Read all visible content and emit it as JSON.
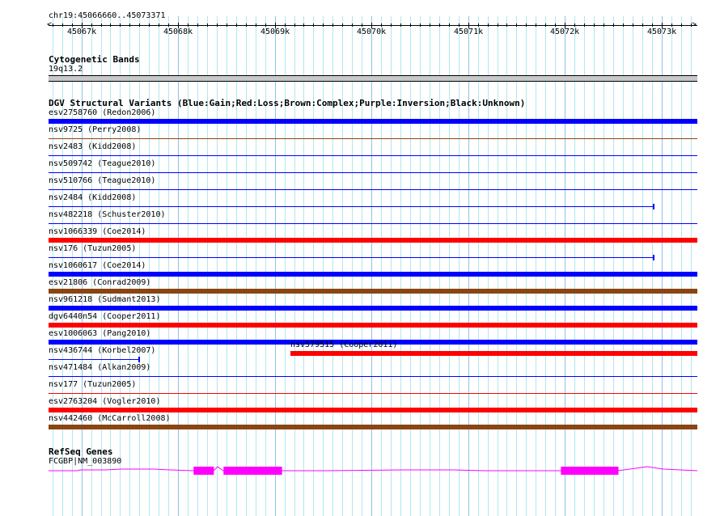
{
  "region": {
    "label": "chr19:45066660..45073371",
    "start": 45066660,
    "end": 45073371
  },
  "ruler": {
    "ticks": [
      "45067k",
      "45068k",
      "45069k",
      "45070k",
      "45071k",
      "45072k",
      "45073k"
    ],
    "tick_values": [
      45067000,
      45068000,
      45069000,
      45070000,
      45071000,
      45072000,
      45073000
    ]
  },
  "cytobands": {
    "title": "Cytogenetic Bands",
    "band": "19q13.2"
  },
  "dgv": {
    "title": "DGV Structural Variants (Blue:Gain;Red:Loss;Brown:Complex;Purple:Inversion;Black:Unknown)",
    "colors": {
      "blue": "#0000ff",
      "red": "#ff0000",
      "brown": "#8b4513"
    },
    "rows": [
      {
        "label": "esv2758760 (Redon2006)",
        "color": "blue",
        "thick": true,
        "start": 45066660,
        "end": 45073371
      },
      {
        "label": "nsv9725 (Perry2008)",
        "color": "brown",
        "thick": false,
        "start": 45066660,
        "end": 45073371
      },
      {
        "label": "nsv2483 (Kidd2008)",
        "color": "blue",
        "thick": false,
        "start": 45066660,
        "end": 45073371
      },
      {
        "label": "nsv509742 (Teague2010)",
        "color": "blue",
        "thick": false,
        "start": 45066660,
        "end": 45073371
      },
      {
        "label": "nsv510766 (Teague2010)",
        "color": "blue",
        "thick": false,
        "start": 45066660,
        "end": 45073371
      },
      {
        "label": "nsv2484 (Kidd2008)",
        "color": "blue",
        "thick": false,
        "start": 45066660,
        "end": 45072919,
        "endcap": true
      },
      {
        "label": "nsv482218 (Schuster2010)",
        "color": "blue",
        "thick": false,
        "start": 45066660,
        "end": 45073371
      },
      {
        "label": "nsv1066339 (Coe2014)",
        "color": "red",
        "thick": true,
        "start": 45066660,
        "end": 45073371
      },
      {
        "label": "nsv176 (Tuzun2005)",
        "color": "blue",
        "thick": false,
        "start": 45066660,
        "end": 45072919,
        "endcap": true
      },
      {
        "label": "nsv1060617 (Coe2014)",
        "color": "blue",
        "thick": true,
        "start": 45066660,
        "end": 45073371
      },
      {
        "label": "esv21806 (Conrad2009)",
        "color": "brown",
        "thick": true,
        "start": 45066660,
        "end": 45073371
      },
      {
        "label": "nsv961218 (Sudmant2013)",
        "color": "blue",
        "thick": true,
        "start": 45066660,
        "end": 45073371
      },
      {
        "label": "dgv6440n54 (Cooper2011)",
        "color": "red",
        "thick": true,
        "start": 45066660,
        "end": 45073371
      },
      {
        "label": "esv1006063 (Pang2010)",
        "color": "blue",
        "thick": true,
        "start": 45066660,
        "end": 45073371
      },
      {
        "label": "nsv436744 (Korbel2007)",
        "color": "blue",
        "thick": false,
        "start": 45066660,
        "end": 45067597,
        "endcap": true,
        "extra": {
          "label": "nsv579515 (Cooper2011)",
          "color": "red",
          "thick": true,
          "start": 45069162,
          "end": 45073371
        }
      },
      {
        "label": "nsv471484 (Alkan2009)",
        "color": "blue",
        "thick": false,
        "start": 45066660,
        "end": 45073371
      },
      {
        "label": "nsv177 (Tuzun2005)",
        "color": "red",
        "thick": false,
        "start": 45066660,
        "end": 45073371
      },
      {
        "label": "esv2763204 (Vogler2010)",
        "color": "red",
        "thick": true,
        "start": 45066660,
        "end": 45073371
      },
      {
        "label": "nsv442460 (McCarroll2008)",
        "color": "brown",
        "thick": true,
        "start": 45066660,
        "end": 45073371
      }
    ]
  },
  "refseq": {
    "title": "RefSeq Genes",
    "gene": "FCGBP|NM_003890",
    "color": "#ff00ff",
    "exons": [
      [
        45068160,
        45068370
      ],
      [
        45068470,
        45069075
      ],
      [
        45071960,
        45072555
      ]
    ]
  }
}
